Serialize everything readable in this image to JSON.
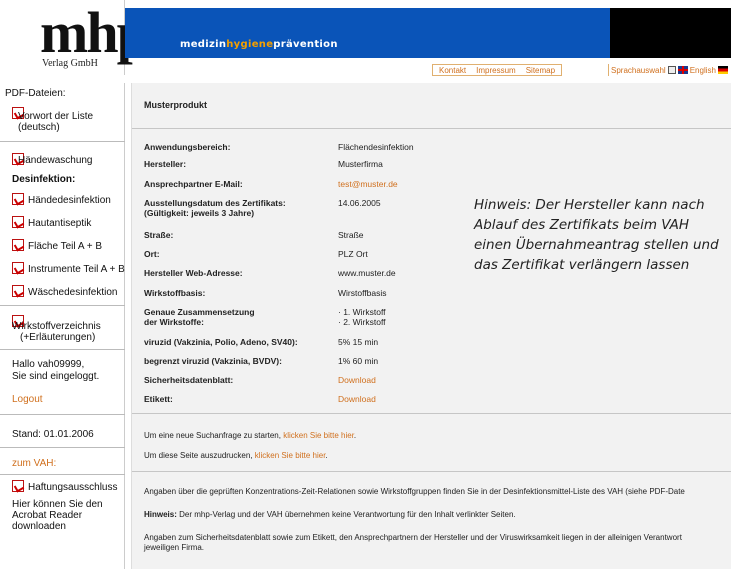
{
  "header": {
    "logo": "mhp",
    "logo_sub": "Verlag GmbH",
    "tagline_parts": [
      "medizin",
      "hygiene",
      "prävention"
    ],
    "nav": [
      "Kontakt",
      "Impressum",
      "Sitemap"
    ],
    "lang_label": "Sprachauswahl",
    "lang_current": "English"
  },
  "sidebar": {
    "heading": "PDF-Dateien:",
    "vorwort_line1": "Vorwort der Liste",
    "vorwort_line2": "(deutsch)",
    "haendewaschung": "Händewaschung",
    "desinfektion_heading": "Desinfektion:",
    "items": [
      "Händedesinfektion",
      "Hautantiseptik",
      "Fläche Teil A + B",
      "Instrumente Teil A + B",
      "Wäschedesinfektion"
    ],
    "verzeichnis_line1": "Wirkstoffverzeichnis",
    "verzeichnis_line2": "(+Erläuterungen)",
    "greeting_line1": "Hallo vah09999,",
    "greeting_line2": "Sie sind eingeloggt.",
    "logout": "Logout",
    "stand": "Stand:  01.01.2006",
    "zum_vah": "zum VAH:",
    "haftung": "Haftungsausschluss",
    "acrobat_line1": "Hier können Sie den",
    "acrobat_line2": "Acrobat Reader",
    "acrobat_line3": "downloaden"
  },
  "main": {
    "title": "Musterprodukt",
    "rows": [
      {
        "label": "Anwendungsbereich:",
        "value": "Flächendesinfektion"
      },
      {
        "label": "Hersteller:",
        "value": "Musterfirma"
      },
      {
        "label": "Ansprechpartner E-Mail:",
        "value": "test@muster.de"
      },
      {
        "label": "Ausstellungsdatum des Zertifikats:",
        "label2": "(Gültigkeit: jeweils 3 Jahre)",
        "value": "14.06.2005"
      },
      {
        "label": "Straße:",
        "value": "Straße"
      },
      {
        "label": "Ort:",
        "value": "PLZ Ort"
      },
      {
        "label": "Hersteller Web-Adresse:",
        "value": "www.muster.de"
      },
      {
        "label": "Wirkstoffbasis:",
        "value": "Wirstoffbasis"
      },
      {
        "label": "Genaue Zusammensetzung",
        "label2": "der Wirkstoffe:",
        "value": "· 1. Wirkstoff",
        "value2": "· 2. Wirkstoff"
      },
      {
        "label": "viruzid (Vakzinia, Polio, Adeno, SV40):",
        "value": "5% 15 min"
      },
      {
        "label": "begrenzt viruzid (Vakzinia, BVDV):",
        "value": "1% 60 min"
      },
      {
        "label": "Sicherheitsdatenblatt:",
        "value": "Download"
      },
      {
        "label": "Etikett:",
        "value": "Download"
      }
    ],
    "search_text": "Um eine neue Suchanfrage zu starten,",
    "search_link": "klicken Sie bitte hier",
    "print_text": "Um diese Seite auszudrucken,",
    "print_link": "klicken Sie bitte hier",
    "note1": "Angaben über die geprüften Konzentrations-Zeit-Relationen sowie Wirkstoffgruppen finden Sie in der Desinfektionsmittel-Liste des VAH (siehe PDF-Date",
    "note2_bold": "Hinweis:",
    "note2": "Der mhp-Verlag und der VAH übernehmen keine Verantwortung für den Inhalt verlinkter Seiten.",
    "note3_line1": "Angaben zum Sicherheitsdatenblatt sowie zum Etikett, den Ansprechpartnern der Hersteller und der Viruswirksamkeit liegen in der alleinigen Verantwort",
    "note3_line2": "jeweiligen Firma."
  },
  "annotation": "Hinweis: Der Hersteller kann nach Ablauf des Zertifikats beim VAH einen Übernahmeantrag stellen und das Zertifikat verlängern lassen",
  "colors": {
    "brand_blue": "#0a54b8",
    "accent_orange": "#d0701e",
    "tagline_highlight": "#f5a000"
  }
}
